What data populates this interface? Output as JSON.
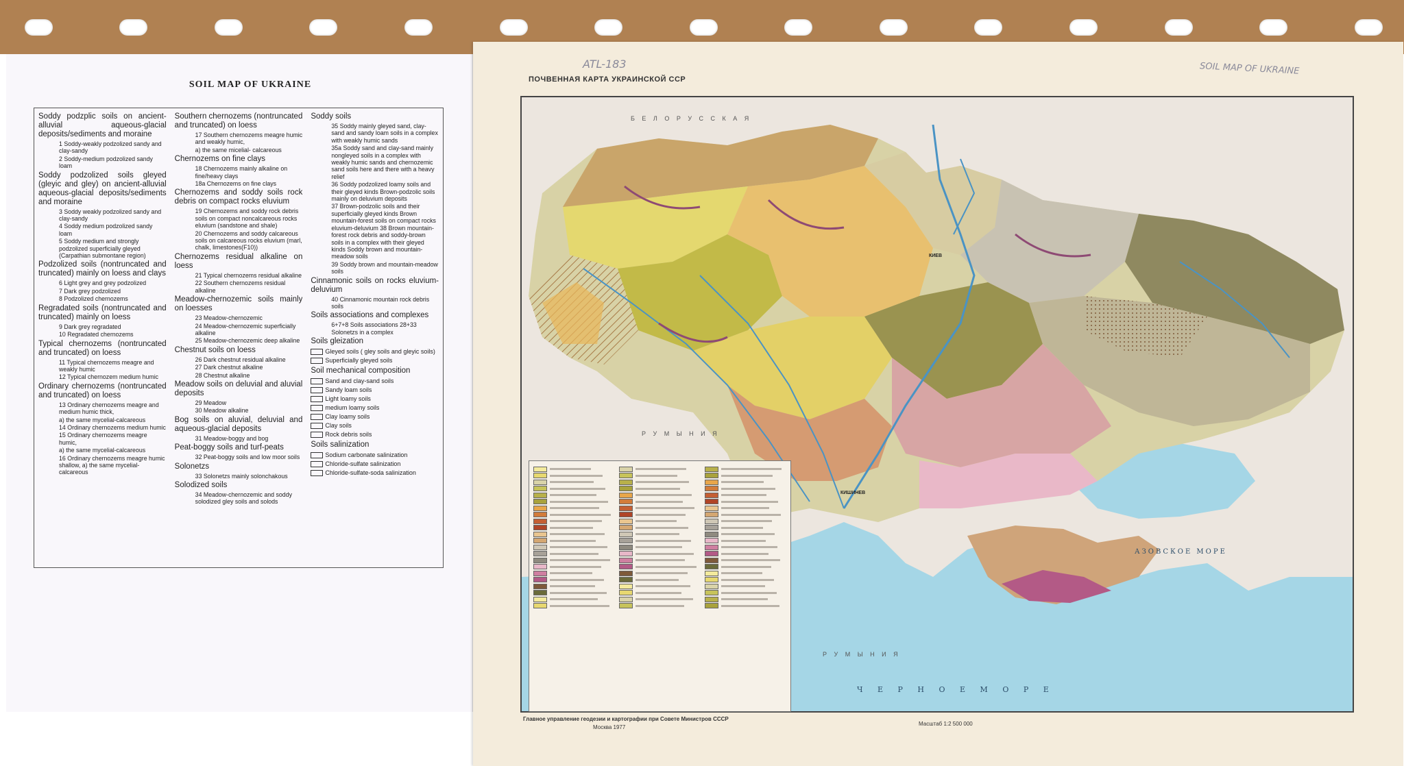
{
  "translation": {
    "title": "SOIL MAP OF UKRAINE",
    "columns": [
      [
        {
          "t": "group",
          "text": "Soddy podzplic soils on ancient-alluvial aqueous-glacial deposits/sediments and moraine"
        },
        {
          "t": "item",
          "text": "1 Soddy-weakly podzolized sandy and clay-sandy"
        },
        {
          "t": "item",
          "text": "2 Soddy-medium podzolized sandy loam"
        },
        {
          "t": "group",
          "text": "Soddy podzolized soils gleyed (gleyic and gley) on ancient-alluvial aqueous-glacial deposits/sediments and moraine"
        },
        {
          "t": "item",
          "text": "3 Soddy weakly podzolized sandy and clay-sandy"
        },
        {
          "t": "item",
          "text": "4 Soddy medium podzolized sandy loam"
        },
        {
          "t": "item",
          "text": "5 Soddy medium and strongly podzolized superficially gleyed (Carpathian submontane region)"
        },
        {
          "t": "group",
          "text": "Podzolized soils (nontruncated and truncated) mainly on loess and clays"
        },
        {
          "t": "item",
          "text": "6 Light grey and grey podzolized"
        },
        {
          "t": "item",
          "text": "7 Dark grey podzolized"
        },
        {
          "t": "item",
          "text": "8 Podzolized chernozems"
        },
        {
          "t": "group",
          "text": "Regradated soils (nontruncated and truncated) mainly on loess"
        },
        {
          "t": "item",
          "text": "9 Dark grey regradated"
        },
        {
          "t": "item",
          "text": "10 Regradated chernozems"
        },
        {
          "t": "group",
          "text": "Typical chernozems (nontruncated and truncated) on loess"
        },
        {
          "t": "item",
          "text": "11 Typical chernozems meagre and weakly humic"
        },
        {
          "t": "item",
          "text": "12 Typical chernozem medium humic"
        },
        {
          "t": "group",
          "text": "Ordinary chernozems (nontruncated and truncated) on loess"
        },
        {
          "t": "item",
          "text": "13 Ordinary chernozems meagre and medium humic thick,"
        },
        {
          "t": "item",
          "text": "a) the same mycelial-calcareous"
        },
        {
          "t": "item",
          "text": "14 Ordinary chernozems medium humic"
        },
        {
          "t": "item",
          "text": "15 Ordinary chernozems meagre humic,"
        },
        {
          "t": "item",
          "text": "a) the same mycelial-calcareous"
        },
        {
          "t": "item",
          "text": "16 Ordinary chernozems meagre humic shallow, a) the same mycelial-calcareous"
        }
      ],
      [
        {
          "t": "group",
          "text": "Southern chernozems (nontruncated and truncated) on loess"
        },
        {
          "t": "item",
          "text": "17 Southern chernozems meagre humic and weakly humic,"
        },
        {
          "t": "item",
          "text": "a) the same micelial- calcareous"
        },
        {
          "t": "group",
          "text": "Chernozems on fine clays"
        },
        {
          "t": "item",
          "text": "18 Chernozems mainly alkaline on fine/heavy clays"
        },
        {
          "t": "item",
          "text": "18a Chernozems on fine clays"
        },
        {
          "t": "group",
          "text": "Chernozems and soddy soils rock debris on compact rocks eluvium"
        },
        {
          "t": "item",
          "text": "19 Chernozems and soddy rock debris soils on compact noncalcareous rocks eluvium (sandstone and shale)"
        },
        {
          "t": "item",
          "text": "20 Chernozems and soddy calcareous soils on calcareous rocks eluvium (marl, chalk, limestones(F10))"
        },
        {
          "t": "group",
          "text": "Chernozems residual alkaline on loess"
        },
        {
          "t": "item",
          "text": "21 Typical chernozems residual alkaline"
        },
        {
          "t": "item",
          "text": "22 Southern chernozems residual alkaline"
        },
        {
          "t": "group",
          "text": "Meadow-chernozemic soils mainly on loesses"
        },
        {
          "t": "item",
          "text": "23 Meadow-chernozemic"
        },
        {
          "t": "item",
          "text": "24 Meadow-chernozemic superficially alkaline"
        },
        {
          "t": "item",
          "text": "25 Meadow-chernozemic deep alkaline"
        },
        {
          "t": "group",
          "text": "Chestnut soils on loess"
        },
        {
          "t": "item",
          "text": "26 Dark chestnut residual alkaline"
        },
        {
          "t": "item",
          "text": "27 Dark chestnut alkaline"
        },
        {
          "t": "item",
          "text": "28 Chestnut alkaline"
        },
        {
          "t": "group",
          "text": "Meadow soils on deluvial and aluvial deposits"
        },
        {
          "t": "item",
          "text": "29 Meadow"
        },
        {
          "t": "item",
          "text": "30 Meadow alkaline"
        },
        {
          "t": "group",
          "text": "Bog soils on aluvial, deluvial and aqueous-glacial deposits"
        },
        {
          "t": "item",
          "text": "31 Meadow-boggy and bog"
        },
        {
          "t": "group",
          "text": "Peat-boggy soils and turf-peats"
        },
        {
          "t": "item",
          "text": "32 Peat-boggy soils and low moor soils"
        },
        {
          "t": "group",
          "text": "Solonetzs"
        },
        {
          "t": "item",
          "text": "33 Solonetzs mainly solonchakous"
        },
        {
          "t": "group",
          "text": "Solodized soils"
        },
        {
          "t": "item",
          "text": "34 Meadow-chernozemic and soddy solodized gley soils and solods"
        }
      ],
      [
        {
          "t": "group",
          "text": "Soddy soils"
        },
        {
          "t": "item",
          "text": "35 Soddy mainly gleyed sand, clay-sand and sandy loam soils in a complex with weakly humic sands"
        },
        {
          "t": "item",
          "text": "35a Soddy sand and clay-sand mainly nongleyed soils in a complex with weakly humic sands and chernozemic sand soils here and there with a heavy relief"
        },
        {
          "t": "item",
          "text": "36 Soddy podzolized loamy soils and their gleyed kinds Brown-podzolic soils mainly on deluvium deposits"
        },
        {
          "t": "item",
          "text": "37 Brown-podzolic soils and their superficially gleyed kinds Brown mountain-forest soils on compact rocks eluvium-deluvium 38 Brown mountain-forest rock debris and soddy-brown soils in a complex with their gleyed kinds Soddy brown and mountain-meadow soils"
        },
        {
          "t": "item",
          "text": "39 Soddy brown and mountain-meadow soils"
        },
        {
          "t": "group",
          "text": "Cinnamonic soils on rocks eluvium-deluvium"
        },
        {
          "t": "item",
          "text": "40 Cinnamonic mountain rock debris soils"
        },
        {
          "t": "group",
          "text": "Soils associations and complexes"
        },
        {
          "t": "item",
          "text": "6+7+8 Soils associations 28+33 Solonetzs in a complex"
        },
        {
          "t": "group",
          "text": "Soils gleization"
        },
        {
          "t": "sym",
          "text": "Gleyed soils ( gley soils and gleyic soils)"
        },
        {
          "t": "sym",
          "text": "Superficially gleyed soils"
        },
        {
          "t": "group",
          "text": "Soil mechanical composition"
        },
        {
          "t": "sym",
          "text": "Sand and clay-sand soils"
        },
        {
          "t": "sym",
          "text": "Sandy loam soils"
        },
        {
          "t": "sym",
          "text": "Light loamy soils"
        },
        {
          "t": "sym",
          "text": "medium loamy soils"
        },
        {
          "t": "sym",
          "text": "Clay loamy soils"
        },
        {
          "t": "sym",
          "text": "Clay soils"
        },
        {
          "t": "sym",
          "text": "Rock debris soils"
        },
        {
          "t": "group",
          "text": "Soils salinization"
        },
        {
          "t": "sym",
          "text": "Sodium carbonate salinization"
        },
        {
          "t": "sym",
          "text": "Chloride-sulfate salinization"
        },
        {
          "t": "sym",
          "text": "Chloride-sulfate-soda salinization"
        }
      ]
    ]
  },
  "map": {
    "title": "ПОЧВЕННАЯ КАРТА УКРАИНСКОЙ ССР",
    "handwritten_id": "ATL-183",
    "handwritten_name": "SOIL MAP OF UKRAINE",
    "labels": {
      "sea_black": "Ч Е Р Н О Е   М О Р Е",
      "sea_azov": "АЗОВСКОЕ МОРЕ",
      "belarus": "Б Е Л О Р У С С К А Я",
      "romania": "Р У М Ы Н И Я",
      "romania2": "Р У М Ы Н И Я",
      "kishinev": "КИШИНЕВ",
      "kiev": "КИЕВ"
    },
    "footer_left_1": "Главное управление геодезии и картографии при Совете Министров СССР",
    "footer_left_2": "Москва 1977",
    "scale": "Масштаб 1:2 500 000",
    "legend_colors": [
      "#f3ea9c",
      "#e7d870",
      "#d9d3a8",
      "#c7c35a",
      "#b8b04a",
      "#a9a23c",
      "#e8a64a",
      "#d27c3a",
      "#c45f33",
      "#b04527",
      "#e9c58f",
      "#d4a772",
      "#cfc7b5",
      "#a7a198",
      "#8f8a7f",
      "#e8b7c8",
      "#cf7fa0",
      "#b35a86",
      "#7e5a3a",
      "#6b6b3a"
    ]
  },
  "colors": {
    "binder": "#b08152",
    "sea": "#9fd3e2",
    "sea_deep": "#7cc0d8"
  }
}
